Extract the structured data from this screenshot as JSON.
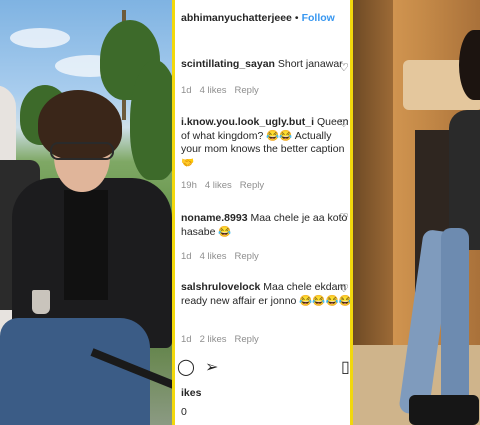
{
  "post": {
    "username": "abhimanyuchatterjeee",
    "separator": "•",
    "follow_label": "Follow",
    "more_label": "⋮"
  },
  "comments": [
    {
      "author": "scintillating_sayan",
      "text": "Short janawar",
      "time": "1d",
      "likes": "4 likes",
      "reply": "Reply"
    },
    {
      "author": "i.know.you.look_ugly.but_i",
      "text": "Queen of what kingdom? 😂😂 Actually your mom knows the better caption 🤝",
      "time": "19h",
      "likes": "4 likes",
      "reply": "Reply"
    },
    {
      "author": "noname.8993",
      "text": "Maa chele je aa koto hasabe 😂",
      "time": "1d",
      "likes": "4 likes",
      "reply": "Reply"
    },
    {
      "author": "salshrulovelock",
      "text": "Maa chele ekdam ready new affair er jonno 😂😂😂😂",
      "time": "1d",
      "likes": "2 likes",
      "reply": "Reply"
    }
  ],
  "icons": {
    "heart": "♡",
    "comment": "◯",
    "share": "➢",
    "bookmark": "▯"
  },
  "footer": {
    "likes_label": "ikes",
    "count": "0"
  }
}
